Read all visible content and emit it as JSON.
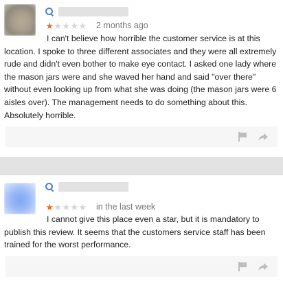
{
  "reviews": [
    {
      "rating": 1,
      "max_rating": 5,
      "date": "2 months ago",
      "text": "I can't believe how horrible the customer service is at this location. I spoke to three different associates and they were all extremely rude and didn't even bother to make eye contact. I asked one lady where the mason jars were and she waved her hand and said \"over there\" without even looking up from what she was doing (the mason jars were 6 aisles over). The management needs to do something about this. Absolutely horrible."
    },
    {
      "rating": 1,
      "max_rating": 5,
      "date": "in the last week",
      "text": "I cannot give this place even a star, but it is mandatory to publish this review. It seems that the customers service staff has been trained for the worst performance."
    }
  ],
  "icons": {
    "search": "search-icon",
    "flag": "flag-icon",
    "share": "share-icon"
  },
  "colors": {
    "star_filled": "#e7711b",
    "star_empty": "#d5d5d5",
    "accent": "#4a7fd6",
    "separator": "#e3e3e3"
  }
}
